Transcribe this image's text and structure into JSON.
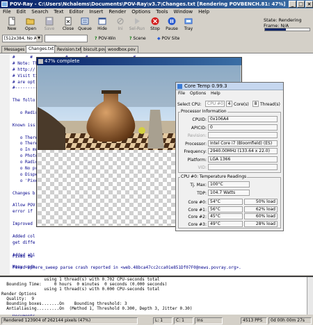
{
  "window": {
    "title": "POV-Ray - C:\\Users\\Nchalems\\Documents\\POV-Ray\\v3.7\\Changes.txt [Rendering POVBENCH.81: 47%]"
  },
  "menu": [
    "File",
    "Edit",
    "Search",
    "Text",
    "Editor",
    "Insert",
    "Render",
    "Options",
    "Tools",
    "Window",
    "Help"
  ],
  "toolbar": {
    "buttons": [
      {
        "label": "New",
        "icon": "new-file-icon"
      },
      {
        "label": "Open",
        "icon": "open-folder-icon"
      },
      {
        "label": "Save",
        "icon": "save-icon"
      },
      {
        "label": "Close",
        "icon": "close-doc-icon"
      },
      {
        "label": "Queue",
        "icon": "queue-icon"
      },
      {
        "label": "Hide",
        "icon": "hide-icon"
      },
      {
        "label": "Ini",
        "icon": "ini-icon"
      },
      {
        "label": "Sel-Run",
        "icon": "sel-run-icon"
      },
      {
        "label": "Stop",
        "icon": "stop-icon"
      },
      {
        "label": "Pause",
        "icon": "pause-icon"
      },
      {
        "label": "Tray",
        "icon": "tray-icon"
      }
    ]
  },
  "status_panel": {
    "state_label": "State:",
    "state_value": "Rendering",
    "frame_label": "Frame:",
    "frame_value": "N/A",
    "progress": 0.47
  },
  "toolbar2": {
    "resolution": "[512x384, No AA]",
    "povwin_label": "POV-Win",
    "scene_label": "Scene",
    "povsite_label": "POV Site"
  },
  "tabs": [
    "Messages",
    "Changes.txt",
    "Revision.txt",
    "biscuit.pov",
    "woodbox.pov"
  ],
  "editor": {
    "lines": [
      "#      #             #       #                  #",
      "# Note: Th",
      "# http://",
      "# Visit ti",
      "# are opt",
      "#------------------",
      "",
      "The follo",
      "",
      "   o Redir",
      "",
      "Known iss",
      "",
      "   o There",
      "   o There",
      "   o In mo",
      "   o Photo",
      "   o Radio",
      "   o No pr",
      "   o Dispe",
      "   o 'Pixe",
      "",
      "Changes b",
      "",
      "Allow POV",
      "error if",
      "",
      "Improved",
      "",
      "Added col",
      "get diffe",
      "",
      "Added abi",
      "",
      "Many upda",
      "",
      "Worked ar",
      "range of",
      "around ti",
      "since now",
      "",
      "Moved ass",
      "Documents"
    ],
    "fixed_line": "Fixed tw",
    "bottom_line": "Fixed sphere_sweep parse crash reported in <web.48bca47cc2cca01e851Df07F0@news.povray.org>."
  },
  "render_window": {
    "title": "47% complete"
  },
  "coretemp": {
    "title": "Core Temp 0.99.3",
    "menu": [
      "File",
      "Options",
      "Help"
    ],
    "select_cpu_label": "Select CPU:",
    "select_cpu_value": "CPU #0",
    "cores_value": "4",
    "cores_label": "Core(s)",
    "threads_value": "8",
    "threads_label": "Thread(s)",
    "info_group": "Processor Information",
    "info": [
      {
        "label": "CPUID:",
        "value": "0x106A4"
      },
      {
        "label": "APICID:",
        "value": "0"
      },
      {
        "label": "Revision:",
        "value": ""
      },
      {
        "label": "Processor:",
        "value": "Intel Core i7 (Bloomfield) (ES)"
      },
      {
        "label": "Frequency:",
        "value": "2940.00MHz (133.64 x 22.0)"
      },
      {
        "label": "Platform:",
        "value": "LGA 1366"
      },
      {
        "label": "VID:",
        "value": ""
      }
    ],
    "temp_group": "CPU #0: Temperature Readings",
    "tjmax_label": "Tj. Max:",
    "tjmax_value": "100°C",
    "tdp_label": "TDP:",
    "tdp_value": "104.7 Watts",
    "cores": [
      {
        "label": "Core #0:",
        "temp": "54°C",
        "load": "50% load"
      },
      {
        "label": "Core #1:",
        "temp": "56°C",
        "load": "62% load"
      },
      {
        "label": "Core #2:",
        "temp": "45°C",
        "load": "60% load"
      },
      {
        "label": "Core #3:",
        "temp": "49°C",
        "load": "28% load"
      }
    ]
  },
  "output": {
    "lines": [
      "                 using 1 thread(s) with 0.702 CPU-seconds total",
      "  Bounding Time:     0 hours  0 minutes  0 seconds (0.000 seconds)",
      "                 using 1 thread(s) with 0.000 CPU-seconds total",
      "",
      "Render Options",
      "  Quality:  9",
      "  Bounding boxes.......On    Bounding threshold: 3",
      "  Antialiasing.........On  (Method 1, Threshold 0.300, Depth 3, Jitter 0.30)"
    ]
  },
  "statusbar": {
    "rendered": "Rendered 123904 of 262144 pixels (47%)",
    "line": "L: 1",
    "col": "C: 1",
    "ins": "Ins",
    "pps": "4513 PPS",
    "time": "0d 00h 00m 27s"
  }
}
